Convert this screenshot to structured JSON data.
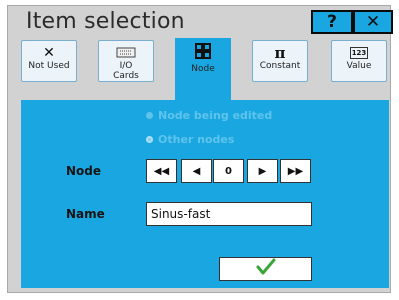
{
  "window": {
    "title": "Item selection",
    "help_label": "?",
    "close_label": "✕"
  },
  "tabs": [
    {
      "label": "Not Used",
      "icon": "x-icon"
    },
    {
      "label": "I/O\nCards",
      "icon": "io-card-icon"
    },
    {
      "label": "Node",
      "icon": "node-grid-icon",
      "active": true
    },
    {
      "label": "Constant",
      "icon": "pi-icon"
    },
    {
      "label": "Value",
      "icon": "value-123-icon"
    }
  ],
  "tab_icons": {
    "not_used": "✕",
    "constant": "π",
    "value_text": "123"
  },
  "options": {
    "node_being_edited": "Node being edited",
    "other_nodes": "Other nodes",
    "selected": "other_nodes"
  },
  "node": {
    "label": "Node",
    "value": "0",
    "first": "◀◀",
    "prev": "◀",
    "next": "▶",
    "last": "▶▶"
  },
  "name": {
    "label": "Name",
    "value": "Sinus-fast"
  },
  "ok": {
    "icon": "checkmark-icon"
  },
  "colors": {
    "accent": "#1aa6e0",
    "panel": "#d2d2d2",
    "ok_check": "#3aa63a"
  }
}
